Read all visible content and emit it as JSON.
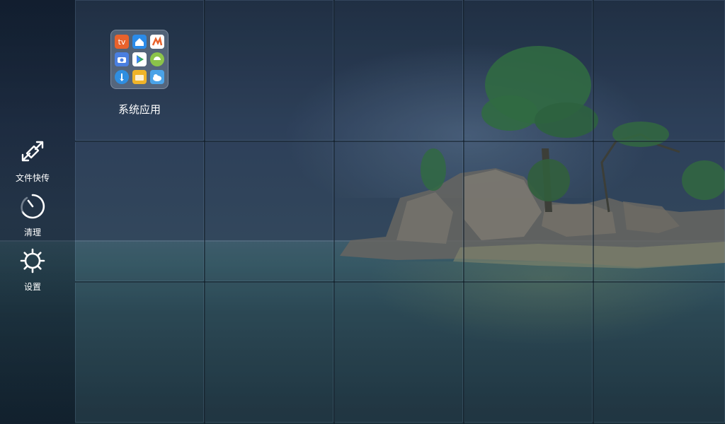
{
  "sidebar": {
    "items": [
      {
        "label": "文件快传",
        "icon": "file-transfer-icon"
      },
      {
        "label": "清理",
        "icon": "cleanup-icon"
      },
      {
        "label": "设置",
        "icon": "gear-icon"
      }
    ]
  },
  "folder": {
    "label": "系统应用",
    "apps": [
      {
        "icon": "tv-app-icon",
        "color": "#e8622c"
      },
      {
        "icon": "home-app-icon",
        "color": "#2b8be8"
      },
      {
        "icon": "m-app-icon",
        "color": "#ffffff"
      },
      {
        "icon": "camera-app-icon",
        "color": "#4a7fe0"
      },
      {
        "icon": "play-store-icon",
        "color": "#ffffff"
      },
      {
        "icon": "android-app-icon",
        "color": "#8bc34a"
      },
      {
        "icon": "touch-app-icon",
        "color": "#2f8ee0"
      },
      {
        "icon": "file-manager-icon",
        "color": "#f0b429"
      },
      {
        "icon": "cloud-app-icon",
        "color": "#4aa3e8"
      }
    ]
  },
  "colors": {
    "label_text": "#ffffff",
    "background": "#2a3c55"
  }
}
